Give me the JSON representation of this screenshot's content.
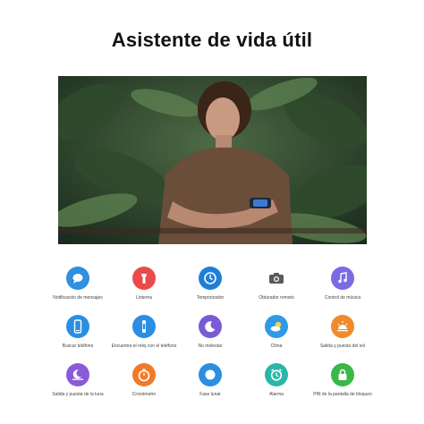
{
  "page": {
    "title": "Asistente de vida útil"
  },
  "features": [
    {
      "label": "Notificación de mensajes",
      "icon": "message-bubble-icon",
      "color": "#2f8fe0"
    },
    {
      "label": "Linterna",
      "icon": "flashlight-icon",
      "color": "#ea4a4a"
    },
    {
      "label": "Temporizador",
      "icon": "stopwatch-icon",
      "color": "#1f7fd6"
    },
    {
      "label": "Obturador remoto",
      "icon": "camera-icon",
      "color": "#5a5a5a"
    },
    {
      "label": "Control de música",
      "icon": "music-note-icon",
      "color": "#7a6ae6"
    },
    {
      "label": "Buscar teléfono",
      "icon": "phone-icon",
      "color": "#2a8ee2"
    },
    {
      "label": "Encuentra el reloj con el teléfono",
      "icon": "watch-search-icon",
      "color": "#2a8ee2"
    },
    {
      "label": "No molestar",
      "icon": "moon-icon",
      "color": "#7a5ad8"
    },
    {
      "label": "Clima",
      "icon": "weather-icon",
      "color": "#2f9ae8"
    },
    {
      "label": "Salida y puesta del sol",
      "icon": "sunrise-icon",
      "color": "#f08a2a"
    },
    {
      "label": "Salida y puesta de la luna",
      "icon": "moonrise-icon",
      "color": "#8a5ad8"
    },
    {
      "label": "Cronómetro",
      "icon": "chronometer-icon",
      "color": "#f07a2a"
    },
    {
      "label": "Fase lunar",
      "icon": "moon-phase-icon",
      "color": "#2a8ee2"
    },
    {
      "label": "Alarma",
      "icon": "alarm-icon",
      "color": "#2ab6a8"
    },
    {
      "label": "PIN de la pantalla de bloqueo",
      "icon": "lock-icon",
      "color": "#3ab84a"
    }
  ]
}
